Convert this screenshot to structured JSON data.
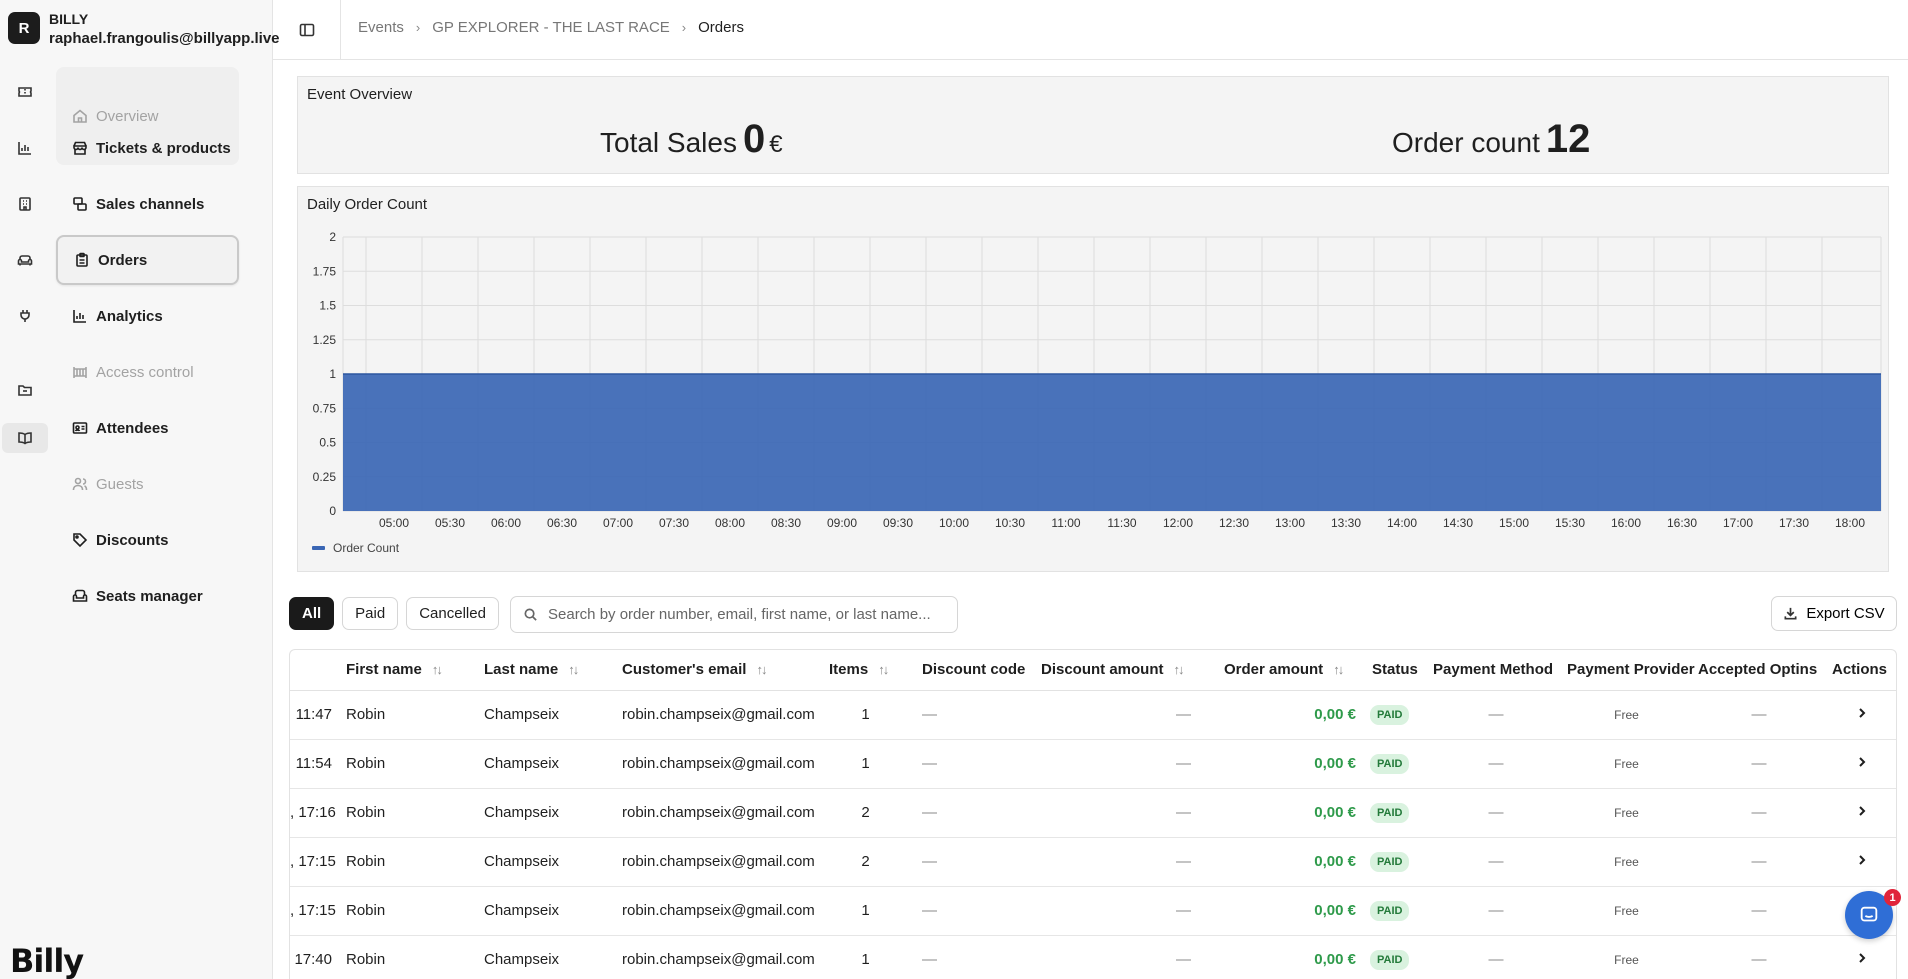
{
  "account": {
    "initial": "R",
    "name": "BILLY",
    "email": "raphael.frangoulis@billyapp.live"
  },
  "rail": [
    {
      "name": "ticket-icon"
    },
    {
      "name": "bar-chart-icon"
    },
    {
      "name": "building-icon"
    },
    {
      "name": "sofa-icon"
    },
    {
      "name": "plug-icon"
    },
    {
      "name": "folder-icon"
    },
    {
      "name": "book-open-icon"
    }
  ],
  "nav": [
    {
      "label": "Overview",
      "icon": "home-icon",
      "state": "disabled"
    },
    {
      "label": "Tickets & products",
      "icon": "store-icon",
      "state": "normal"
    },
    {
      "label": "Sales channels",
      "icon": "channels-icon",
      "state": "normal"
    },
    {
      "label": "Orders",
      "icon": "clipboard-icon",
      "state": "selected"
    },
    {
      "label": "Analytics",
      "icon": "analytics-icon",
      "state": "normal"
    },
    {
      "label": "Access control",
      "icon": "gate-icon",
      "state": "disabled"
    },
    {
      "label": "Attendees",
      "icon": "id-card-icon",
      "state": "normal"
    },
    {
      "label": "Guests",
      "icon": "users-icon",
      "state": "disabled"
    },
    {
      "label": "Discounts",
      "icon": "tag-icon",
      "state": "normal"
    },
    {
      "label": "Seats manager",
      "icon": "armchair-icon",
      "state": "normal"
    }
  ],
  "logo": "Billy",
  "breadcrumb": [
    "Events",
    "GP EXPLORER - THE LAST RACE",
    "Orders"
  ],
  "overview": {
    "title": "Event Overview",
    "total_sales_label": "Total Sales",
    "total_sales_value": "0",
    "currency": "€",
    "order_count_label": "Order count",
    "order_count_value": "12"
  },
  "chart_data": {
    "type": "area",
    "title": "Daily Order Count",
    "x": [
      "05:00",
      "05:30",
      "06:00",
      "06:30",
      "07:00",
      "07:30",
      "08:00",
      "08:30",
      "09:00",
      "09:30",
      "10:00",
      "10:30",
      "11:00",
      "11:30",
      "12:00",
      "12:30",
      "13:00",
      "13:30",
      "14:00",
      "14:30",
      "15:00",
      "15:30",
      "16:00",
      "16:30",
      "17:00",
      "17:30",
      "18:00"
    ],
    "series": [
      {
        "name": "Order Count",
        "values": [
          1,
          1,
          1,
          1,
          1,
          1,
          1,
          1,
          1,
          1,
          1,
          1,
          1,
          1,
          1,
          1,
          1,
          1,
          1,
          1,
          1,
          1,
          1,
          1,
          1,
          1,
          1
        ],
        "color": "#3a66b4"
      }
    ],
    "ylim": [
      0,
      2
    ],
    "yticks": [
      "0",
      "0.25",
      "0.5",
      "0.75",
      "1",
      "1.25",
      "1.5",
      "1.75",
      "2"
    ],
    "grid": true,
    "legend": "bottom-left"
  },
  "filters": {
    "all": "All",
    "paid": "Paid",
    "cancelled": "Cancelled"
  },
  "search": {
    "placeholder": "Search by order number, email, first name, or last name..."
  },
  "export_label": "Export CSV",
  "table": {
    "columns": [
      "First name",
      "Last name",
      "Customer's email",
      "Items",
      "Discount code",
      "Discount amount",
      "Order amount",
      "Status",
      "Payment Method",
      "Payment Provider",
      "Accepted Optins",
      "Actions"
    ],
    "rows": [
      {
        "date": "11:47",
        "first": "Robin",
        "last": "Champseix",
        "email": "robin.champseix@gmail.com",
        "items": "1",
        "code": "—",
        "discount": "—",
        "amount": "0,00 €",
        "status": "PAID",
        "method": "—",
        "provider": "Free",
        "optins": "—"
      },
      {
        "date": "11:54",
        "first": "Robin",
        "last": "Champseix",
        "email": "robin.champseix@gmail.com",
        "items": "1",
        "code": "—",
        "discount": "—",
        "amount": "0,00 €",
        "status": "PAID",
        "method": "—",
        "provider": "Free",
        "optins": "—"
      },
      {
        "date": ", 17:16",
        "first": "Robin",
        "last": "Champseix",
        "email": "robin.champseix@gmail.com",
        "items": "2",
        "code": "—",
        "discount": "—",
        "amount": "0,00 €",
        "status": "PAID",
        "method": "—",
        "provider": "Free",
        "optins": "—"
      },
      {
        "date": ", 17:15",
        "first": "Robin",
        "last": "Champseix",
        "email": "robin.champseix@gmail.com",
        "items": "2",
        "code": "—",
        "discount": "—",
        "amount": "0,00 €",
        "status": "PAID",
        "method": "—",
        "provider": "Free",
        "optins": "—"
      },
      {
        "date": ", 17:15",
        "first": "Robin",
        "last": "Champseix",
        "email": "robin.champseix@gmail.com",
        "items": "1",
        "code": "—",
        "discount": "—",
        "amount": "0,00 €",
        "status": "PAID",
        "method": "—",
        "provider": "Free",
        "optins": "—"
      },
      {
        "date": "17:40",
        "first": "Robin",
        "last": "Champseix",
        "email": "robin.champseix@gmail.com",
        "items": "1",
        "code": "—",
        "discount": "—",
        "amount": "0,00 €",
        "status": "PAID",
        "method": "—",
        "provider": "Free",
        "optins": "—"
      }
    ]
  },
  "chat_badge": "1"
}
